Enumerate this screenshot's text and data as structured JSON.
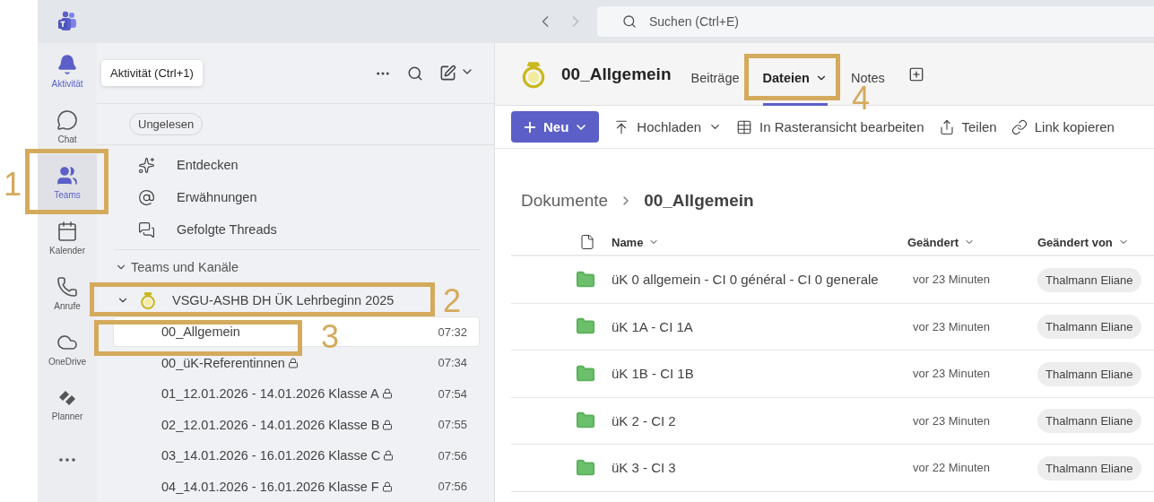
{
  "top_bar": {
    "search": {
      "placeholder": "Suchen (Ctrl+E)"
    }
  },
  "rail": [
    {
      "kind": "bell",
      "label": "Aktivität",
      "selected": false,
      "hovered": true
    },
    {
      "kind": "chat",
      "label": "Chat",
      "selected": false,
      "hovered": false
    },
    {
      "kind": "teams",
      "label": "Teams",
      "selected": true,
      "hovered": false
    },
    {
      "kind": "calendar",
      "label": "Kalender",
      "selected": false,
      "hovered": false
    },
    {
      "kind": "calls",
      "label": "Anrufe",
      "selected": false,
      "hovered": false
    },
    {
      "kind": "cloud",
      "label": "OneDrive",
      "selected": false,
      "hovered": false
    },
    {
      "kind": "planner",
      "label": "Planner",
      "selected": false,
      "hovered": false
    },
    {
      "kind": "more",
      "selected": false,
      "hovered": false
    }
  ],
  "tooltip": "Aktivität (Ctrl+1)",
  "channel_pane": {
    "filter_chip": "Ungelesen",
    "shortcuts": [
      {
        "kind": "discover",
        "label": "Entdecken"
      },
      {
        "kind": "mentions",
        "label": "Erwähnungen"
      },
      {
        "kind": "threads",
        "label": "Gefolgte Threads"
      }
    ],
    "section": {
      "label": "Teams und Kanäle",
      "expanded": true
    },
    "team": {
      "name": "VSGU-ASHB DH ÜK Lehrbeginn 2025",
      "expanded": true,
      "channels": [
        {
          "name": "00_Allgemein",
          "time": "07:32",
          "private": false,
          "selected": true
        },
        {
          "name": "00_üK-Referentinnen",
          "time": "07:34",
          "private": true,
          "selected": false
        },
        {
          "name": "01_12.01.2026 - 14.01.2026 Klasse A",
          "time": "07:54",
          "private": true,
          "selected": false
        },
        {
          "name": "02_12.01.2026 - 14.01.2026 Klasse B",
          "time": "07:55",
          "private": true,
          "selected": false
        },
        {
          "name": "03_14.01.2026 - 16.01.2026 Klasse C",
          "time": "07:56",
          "private": true,
          "selected": false
        },
        {
          "name": "04_14.01.2026 - 16.01.2026 Klasse F",
          "time": "07:56",
          "private": true,
          "selected": false
        }
      ]
    }
  },
  "main": {
    "title": "00_Allgemein",
    "tabs": [
      {
        "label": "Beiträge",
        "selected": false,
        "dropdown": false
      },
      {
        "label": "Dateien",
        "selected": true,
        "dropdown": true
      },
      {
        "label": "Notes",
        "selected": false,
        "dropdown": false
      }
    ],
    "toolbar": [
      {
        "kind": "new",
        "label": "Neu"
      },
      {
        "kind": "upload",
        "label": "Hochladen"
      },
      {
        "kind": "grid",
        "label": "In Rasteransicht bearbeiten"
      },
      {
        "kind": "share",
        "label": "Teilen"
      },
      {
        "kind": "link",
        "label": "Link kopieren"
      }
    ],
    "breadcrumb": [
      "Dokumente",
      "00_Allgemein"
    ],
    "table": {
      "columns": [
        "Name",
        "Geändert",
        "Geändert von"
      ],
      "rows": [
        {
          "name": "üK 0 allgemein - CI 0 général - CI 0 generale",
          "modified": "vor 23 Minuten",
          "modified_by": "Thalmann Eliane"
        },
        {
          "name": "üK 1A - CI 1A",
          "modified": "vor 23 Minuten",
          "modified_by": "Thalmann Eliane"
        },
        {
          "name": "üK 1B - CI 1B",
          "modified": "vor 23 Minuten",
          "modified_by": "Thalmann Eliane"
        },
        {
          "name": "üK 2 - CI 2",
          "modified": "vor 23 Minuten",
          "modified_by": "Thalmann Eliane"
        },
        {
          "name": "üK 3 - CI 3",
          "modified": "vor 22 Minuten",
          "modified_by": "Thalmann Eliane"
        }
      ]
    }
  },
  "annotations": [
    {
      "label": "1"
    },
    {
      "label": "2"
    },
    {
      "label": "3"
    },
    {
      "label": "4"
    }
  ]
}
